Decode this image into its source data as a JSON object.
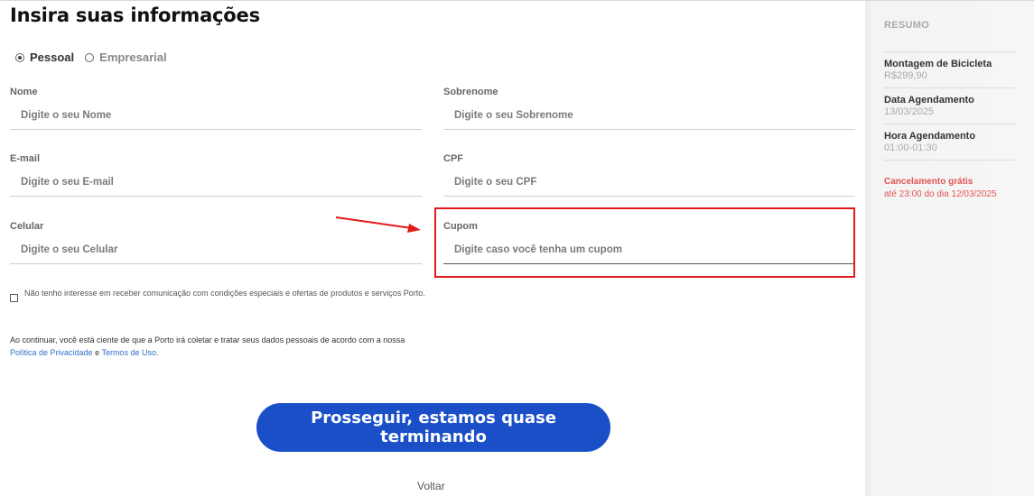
{
  "page": {
    "title": "Insira suas informações"
  },
  "person_type": {
    "options": [
      {
        "label": "Pessoal",
        "selected": true
      },
      {
        "label": "Empresarial",
        "selected": false
      }
    ]
  },
  "form": {
    "nome": {
      "label": "Nome",
      "placeholder": "Digite o seu Nome"
    },
    "sobrenome": {
      "label": "Sobrenome",
      "placeholder": "Digite o seu Sobrenome"
    },
    "email": {
      "label": "E-mail",
      "placeholder": "Digite o seu E-mail"
    },
    "cpf": {
      "label": "CPF",
      "placeholder": "Digite o seu CPF"
    },
    "celular": {
      "label": "Celular",
      "placeholder": "Digite o seu Celular"
    },
    "cupom": {
      "label": "Cupom",
      "placeholder": "Digite caso você tenha um cupom"
    }
  },
  "optout": {
    "text": "Não tenho interesse em receber comunicação com condições especiais e ofertas de produtos e serviços Porto."
  },
  "consent": {
    "text": "Ao continuar, você está ciente de que a Porto irá coletar e tratar seus dados pessoais de acordo com a nossa",
    "privacy_link": "Política de Privacidade",
    "conjunction": "e",
    "terms_link": "Termos de Uso",
    "end": "."
  },
  "actions": {
    "proceed_label": "Prosseguir, estamos quase terminando",
    "back_label": "Voltar"
  },
  "summary": {
    "title": "RESUMO",
    "items": [
      {
        "label": "Montagem de Bicicleta",
        "value": "R$299,90"
      },
      {
        "label": "Data Agendamento",
        "value": "13/03/2025"
      },
      {
        "label": "Hora Agendamento",
        "value": "01:00-01:30"
      }
    ],
    "cancellation": {
      "label": "Cancelamento grátis",
      "detail": "até 23:00 do dia 12/03/2025"
    }
  },
  "colors": {
    "primary": "#1a4fc8",
    "highlight": "#e41a1a",
    "cancel_text": "#e25555",
    "link": "#2f6fc8"
  }
}
